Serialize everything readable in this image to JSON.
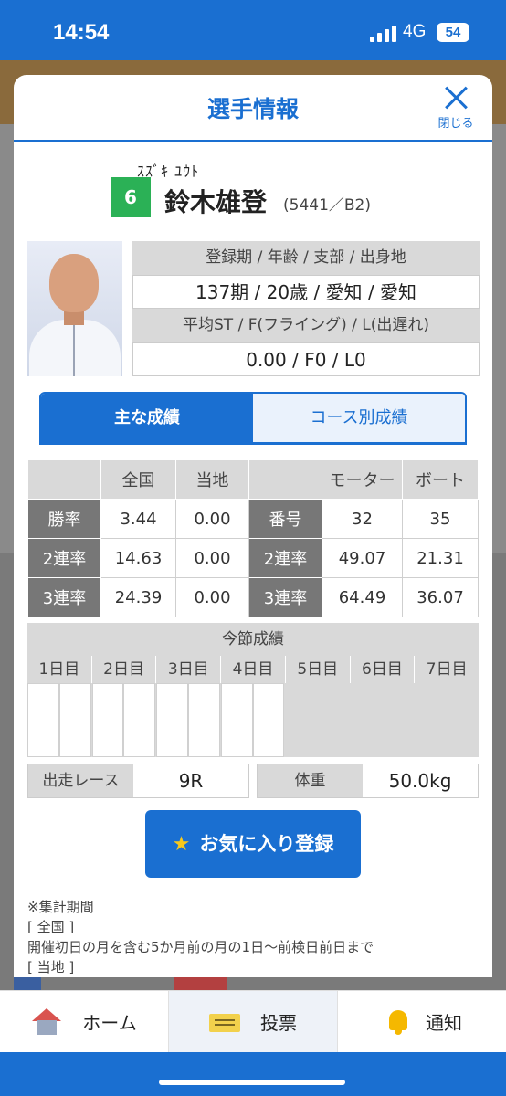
{
  "status_bar": {
    "time": "14:54",
    "network": "4G",
    "battery": "54"
  },
  "modal": {
    "title": "選手情報",
    "close_label": "閉じる"
  },
  "racer": {
    "kana": "ｽｽﾞｷ ﾕｳﾄ",
    "frame_number": "6",
    "name": "鈴木雄登",
    "meta": "(5441／B2)"
  },
  "profile": {
    "header1": "登録期 / 年齢 / 支部 / 出身地",
    "value1": "137期 / 20歳 / 愛知 / 愛知",
    "header2": "平均ST / F(フライング) / L(出遅れ)",
    "value2": "0.00 / F0 / L0"
  },
  "tabs": {
    "main": "主な成績",
    "course": "コース別成績"
  },
  "stats": {
    "col_national": "全国",
    "col_local": "当地",
    "col_motor": "モーター",
    "col_boat": "ボート",
    "rows": [
      {
        "label": "勝率",
        "national": "3.44",
        "local": "0.00",
        "label2": "番号",
        "motor": "32",
        "boat": "35"
      },
      {
        "label": "2連率",
        "national": "14.63",
        "local": "0.00",
        "label2": "2連率",
        "motor": "49.07",
        "boat": "21.31"
      },
      {
        "label": "3連率",
        "national": "24.39",
        "local": "0.00",
        "label2": "3連率",
        "motor": "64.49",
        "boat": "36.07"
      }
    ]
  },
  "session": {
    "title": "今節成績",
    "days": [
      "1日目",
      "2日目",
      "3日目",
      "4日目",
      "5日目",
      "6日目",
      "7日目"
    ]
  },
  "race": {
    "label": "出走レース",
    "value": "9R"
  },
  "weight": {
    "label": "体重",
    "value": "50.0kg"
  },
  "favorite_button": "お気に入り登録",
  "notes": [
    "※集計期間",
    "[ 全国 ]",
    "開催初日の月を含む5か月前の月の1日～前検日前日まで",
    "[ 当地 ]"
  ],
  "nav": {
    "home": "ホーム",
    "vote": "投票",
    "notify": "通知"
  },
  "colors": {
    "accent": "#1a6fd1",
    "frame6": "#2bb156",
    "star": "#f7c81c"
  },
  "icons": {
    "close": "close-icon",
    "star": "star-icon",
    "home": "home-icon",
    "vote": "ticket-icon",
    "notify": "bell-icon"
  }
}
